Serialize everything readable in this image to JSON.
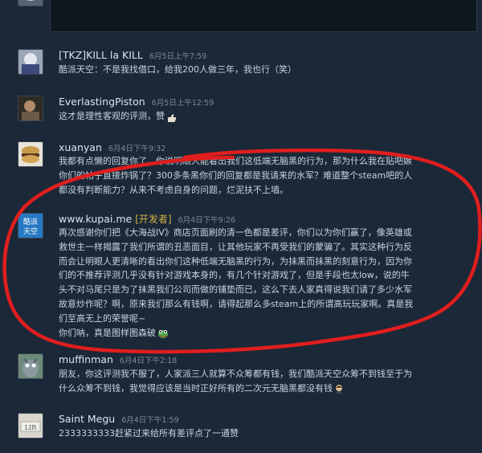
{
  "comments": [
    {
      "name": "[TKZ]KILL la KILL",
      "timestamp": "6月5日上午7:59",
      "lines": [
        "酷派天空：不是我找借口，给我200人做三年，我也行（笑）"
      ]
    },
    {
      "name": "EverlastingPiston",
      "timestamp": "6月5日上午12:59",
      "lines": [
        "这才是理性客观的评测，赞"
      ]
    },
    {
      "name": "xuanyan",
      "timestamp": "6月4日下午9:32",
      "lines": [
        "我都有点懒的回复你了，你说明眼人能看出我们这低端无脑黑的行为，那为什么我在贴吧嫉",
        "你们的帖子直接炸锅了？300多条黑你们的回复都是我请来的水军？难道整个steam吧的人",
        "都没有判断能力？从来不考虑自身的问题，烂泥扶不上墙。"
      ]
    },
    {
      "name": "www.kupai.me",
      "badge": "[开发者]",
      "timestamp": "6月4日下午9:26",
      "lines": [
        "再次感谢你们把《大海战IV》商店页面刷的清一色都是差评，你们以为你们赢了，像英雄或",
        "救世主一样揭露了我们所谓的丑恶面目，让其他玩家不再受我们的蒙骗了。其实这种行为反",
        "而会让明眼人更清晰的看出你们这种低端无脑黑的行为，为抹黑而抹黑的刻意行为，因为你",
        "们的不推荐评测几乎没有针对游戏本身的，有几个针对游戏了，但是手段也太low，说的牛",
        "头不对马尾只是为了抹黑我们公司而做的铺垫而已，这么下去人家真得说我们请了多少水军",
        "故意炒作呢？啊，原来我们那么有钱啊，请得起那么多steam上的所谓高玩玩家啊。真是我",
        "们至高无上的荣誉呢~",
        "你们呐，真是图样图森破"
      ]
    },
    {
      "name": "muffinman",
      "timestamp": "6月4日下午2:18",
      "lines": [
        "朋友，你这评测我不服了，人家派三人就算不众筹都有钱，我们酷派天空众筹不到钱至于为",
        "什么众筹不到钱，我觉得应该是当时正好所有的二次元无脑黑都没有钱"
      ]
    },
    {
      "name": "Saint Megu",
      "timestamp": "6月4日下午1:59",
      "lines": [
        "2333333333赶紧过来给所有差评点了一通赞"
      ]
    }
  ],
  "kupai_avatar_text": [
    "酷派",
    "天空"
  ],
  "megu_avatar_text": "LIR"
}
